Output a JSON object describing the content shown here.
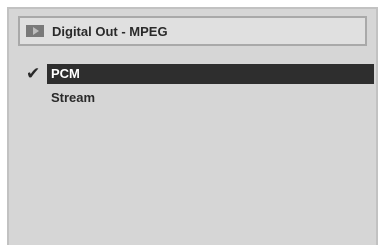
{
  "header": {
    "icon": "play-icon",
    "title": "Digital Out - MPEG"
  },
  "menu": {
    "items": [
      {
        "label": "PCM",
        "selected": true,
        "checked": true
      },
      {
        "label": "Stream",
        "selected": false,
        "checked": false
      }
    ],
    "check_glyph": "✔"
  },
  "colors": {
    "panel_bg": "#d6d6d6",
    "header_bg": "#e0e0e0",
    "highlight_bg": "#2e2e2e",
    "text": "#2a2a2a",
    "highlight_text": "#ffffff"
  }
}
